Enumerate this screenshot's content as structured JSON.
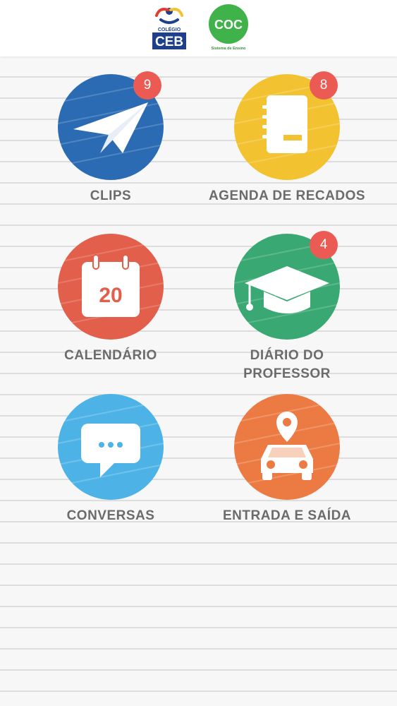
{
  "header": {
    "ceb_logo": {
      "small_text": "COLÉGIO",
      "big_text": "CEB"
    },
    "coc_logo": {
      "big_text": "COC",
      "sub_text": "Sistema de Ensino"
    }
  },
  "colors": {
    "clips": "#2a6bb3",
    "agenda": "#f2c230",
    "calendario": "#e15f4b",
    "diario": "#3aa872",
    "conversas": "#4db3e6",
    "entrada": "#ec7b43",
    "badge": "#ec5b53",
    "label": "#6b6b6b"
  },
  "tiles": [
    {
      "label": "CLIPS",
      "badge": "9",
      "icon": "paper-plane-icon"
    },
    {
      "label": "AGENDA DE RECADOS",
      "badge": "8",
      "icon": "notebook-icon"
    },
    {
      "label": "CALENDÁRIO",
      "badge": "",
      "icon": "calendar-icon",
      "calendar_day": "20"
    },
    {
      "label": "DIÁRIO DO\nPROFESSOR",
      "badge": "4",
      "icon": "graduation-cap-icon"
    },
    {
      "label": "CONVERSAS",
      "badge": "",
      "icon": "chat-bubble-icon"
    },
    {
      "label": "ENTRADA E SAÍDA",
      "badge": "",
      "icon": "car-location-icon"
    }
  ]
}
